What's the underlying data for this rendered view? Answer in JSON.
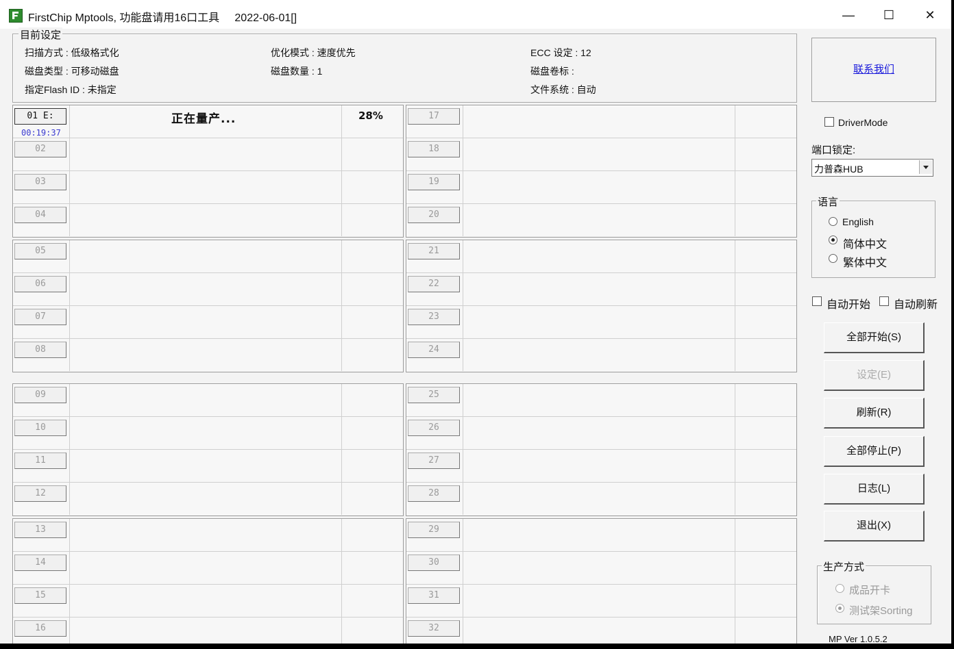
{
  "window": {
    "title": "FirstChip Mptools, 功能盘请用16口工具     2022-06-01[]",
    "controls": {
      "minimize": "—",
      "maximize": "☐",
      "close": "✕"
    }
  },
  "settings": {
    "legend": "目前设定",
    "scan_mode": "扫描方式 : 低级格式化",
    "optimize_mode": "优化模式 : 速度优先",
    "ecc": "ECC 设定 : 12",
    "disk_type": "磁盘类型 : 可移动磁盘",
    "disk_count": "磁盘数量 : 1",
    "volume_label": "磁盘卷标 :",
    "flash_id": "指定Flash ID : 未指定",
    "filesystem": "文件系统 : 自动"
  },
  "ports": {
    "group1": [
      {
        "label": "01 E:",
        "status": "正在量产...",
        "percent": "28%",
        "timer": "00:19:37"
      },
      {
        "label": "02",
        "status": "",
        "percent": ""
      },
      {
        "label": "03",
        "status": "",
        "percent": ""
      },
      {
        "label": "04",
        "status": "",
        "percent": ""
      }
    ],
    "group2": [
      {
        "label": "05"
      },
      {
        "label": "06"
      },
      {
        "label": "07"
      },
      {
        "label": "08"
      }
    ],
    "group3": [
      {
        "label": "09"
      },
      {
        "label": "10"
      },
      {
        "label": "11"
      },
      {
        "label": "12"
      }
    ],
    "group4": [
      {
        "label": "13"
      },
      {
        "label": "14"
      },
      {
        "label": "15"
      },
      {
        "label": "16"
      }
    ],
    "group5": [
      {
        "label": "17"
      },
      {
        "label": "18"
      },
      {
        "label": "19"
      },
      {
        "label": "20"
      }
    ],
    "group6": [
      {
        "label": "21"
      },
      {
        "label": "22"
      },
      {
        "label": "23"
      },
      {
        "label": "24"
      }
    ],
    "group7": [
      {
        "label": "25"
      },
      {
        "label": "26"
      },
      {
        "label": "27"
      },
      {
        "label": "28"
      }
    ],
    "group8": [
      {
        "label": "29"
      },
      {
        "label": "30"
      },
      {
        "label": "31"
      },
      {
        "label": "32"
      }
    ]
  },
  "sidebar": {
    "contact": "联系我们",
    "driver_mode": "DriverMode",
    "port_lock_label": "端口锁定:",
    "port_lock_value": "力普森HUB",
    "language": {
      "legend": "语言",
      "options": [
        "English",
        "简体中文",
        "繁体中文"
      ],
      "selected": "简体中文"
    },
    "auto_start": "自动开始",
    "auto_refresh": "自动刷新",
    "buttons": {
      "start_all": "全部开始(S)",
      "settings": "设定(E)",
      "refresh": "刷新(R)",
      "stop_all": "全部停止(P)",
      "log": "日志(L)",
      "exit": "退出(X)"
    },
    "production": {
      "legend": "生产方式",
      "options": [
        "成品开卡",
        "测试架Sorting"
      ],
      "selected": "测试架Sorting"
    },
    "version": "MP Ver 1.0.5.2"
  }
}
